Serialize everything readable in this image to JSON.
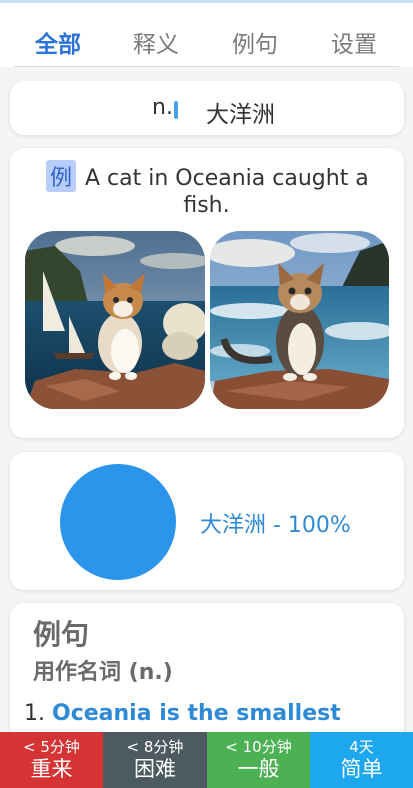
{
  "tabs": [
    {
      "label": "全部",
      "active": true
    },
    {
      "label": "释义",
      "active": false
    },
    {
      "label": "例句",
      "active": false
    },
    {
      "label": "设置",
      "active": false
    }
  ],
  "definition": {
    "pos": "n.",
    "text": "大洋洲"
  },
  "example": {
    "badge": "例",
    "line1": "A cat in Oceania caught a",
    "line2": "fish."
  },
  "meaning_pie": {
    "legend": "大洋洲 - 100%",
    "value": 100,
    "color": "#2b95ec"
  },
  "sentences": {
    "title": "例句",
    "subtitle": "用作名词 (n.)",
    "items": [
      {
        "num": "1.",
        "highlight": "Oceania is the smallest"
      }
    ]
  },
  "review_buttons": [
    {
      "time": "< 5分钟",
      "label": "重来",
      "color": "#d63434"
    },
    {
      "time": "< 8分钟",
      "label": "困难",
      "color": "#4d5a61"
    },
    {
      "time": "< 10分钟",
      "label": "一般",
      "color": "#4cb153"
    },
    {
      "time": "4天",
      "label": "简单",
      "color": "#1da7ee"
    }
  ]
}
